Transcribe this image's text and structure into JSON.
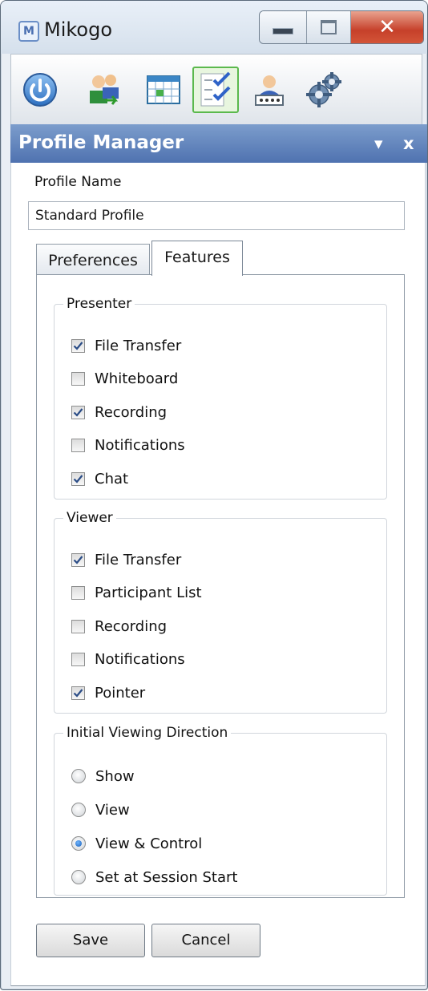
{
  "window": {
    "title": "Mikogo",
    "logo_letter": "M"
  },
  "toolbar": {
    "items": [
      {
        "icon": "power-icon"
      },
      {
        "icon": "participants-icon"
      },
      {
        "icon": "schedule-table-icon"
      },
      {
        "icon": "profile-checklist-icon",
        "active": true
      },
      {
        "icon": "user-password-icon"
      },
      {
        "icon": "settings-gears-icon"
      }
    ]
  },
  "panel": {
    "title": "Profile Manager",
    "collapse_glyph": "▾",
    "close_glyph": "x"
  },
  "profile": {
    "name_label": "Profile Name",
    "name_value": "Standard Profile"
  },
  "tabs": {
    "preferences": "Preferences",
    "features": "Features",
    "active": "Features"
  },
  "presenter": {
    "legend": "Presenter",
    "options": [
      {
        "label": "File Transfer",
        "checked": true
      },
      {
        "label": "Whiteboard",
        "checked": false
      },
      {
        "label": "Recording",
        "checked": true
      },
      {
        "label": "Notifications",
        "checked": false
      },
      {
        "label": "Chat",
        "checked": true
      }
    ]
  },
  "viewer": {
    "legend": "Viewer",
    "options": [
      {
        "label": "File Transfer",
        "checked": true
      },
      {
        "label": "Participant List",
        "checked": false
      },
      {
        "label": "Recording",
        "checked": false
      },
      {
        "label": "Notifications",
        "checked": false
      },
      {
        "label": "Pointer",
        "checked": true
      }
    ]
  },
  "direction": {
    "legend": "Initial Viewing Direction",
    "options": [
      {
        "label": "Show",
        "selected": false
      },
      {
        "label": "View",
        "selected": false
      },
      {
        "label": "View & Control",
        "selected": true
      },
      {
        "label": "Set at Session Start",
        "selected": false
      }
    ]
  },
  "buttons": {
    "save": "Save",
    "cancel": "Cancel"
  },
  "colors": {
    "header": "#5a7bb7",
    "active_tool": "#5bb94d",
    "close": "#c6402a"
  }
}
